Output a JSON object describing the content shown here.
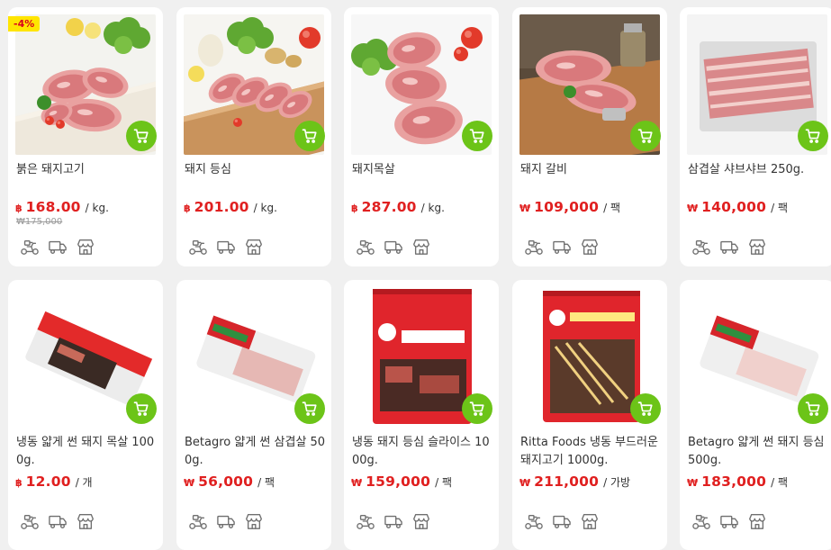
{
  "colors": {
    "accent_green": "#6cc418",
    "price_red": "#e02020",
    "badge_yellow": "#ffe500"
  },
  "icons": [
    "cart-icon",
    "scooter-delivery-icon",
    "truck-delivery-icon",
    "store-pickup-icon"
  ],
  "products": [
    {
      "name": "붉은 돼지고기",
      "currency": "฿",
      "price": "168.00",
      "unit": "/ kg.",
      "old_price": "₩175,000",
      "badge": "-4%"
    },
    {
      "name": "돼지 등심",
      "currency": "฿",
      "price": "201.00",
      "unit": "/ kg.",
      "old_price": "",
      "badge": ""
    },
    {
      "name": "돼지목살",
      "currency": "฿",
      "price": "287.00",
      "unit": "/ kg.",
      "old_price": "",
      "badge": ""
    },
    {
      "name": "돼지 갈비",
      "currency": "₩",
      "price": "109,000",
      "unit": "/ 팩",
      "old_price": "",
      "badge": ""
    },
    {
      "name": "삼겹살 샤브샤브 250g.",
      "currency": "₩",
      "price": "140,000",
      "unit": "/ 팩",
      "old_price": "",
      "badge": ""
    },
    {
      "name": "냉동 얇게 썬 돼지 목살 1000g.",
      "currency": "฿",
      "price": "12.00",
      "unit": "/ 개",
      "old_price": "",
      "badge": ""
    },
    {
      "name": "Betagro 얇게 썬 삼겹살 500g.",
      "currency": "₩",
      "price": "56,000",
      "unit": "/ 팩",
      "old_price": "",
      "badge": ""
    },
    {
      "name": "냉동 돼지 등심 슬라이스 1000g.",
      "currency": "₩",
      "price": "159,000",
      "unit": "/ 팩",
      "old_price": "",
      "badge": ""
    },
    {
      "name": "Ritta Foods 냉동 부드러운 돼지고기 1000g.",
      "currency": "₩",
      "price": "211,000",
      "unit": "/ 가방",
      "old_price": "",
      "badge": ""
    },
    {
      "name": "Betagro 얇게 썬 돼지 등심 500g.",
      "currency": "₩",
      "price": "183,000",
      "unit": "/ 팩",
      "old_price": "",
      "badge": ""
    }
  ]
}
